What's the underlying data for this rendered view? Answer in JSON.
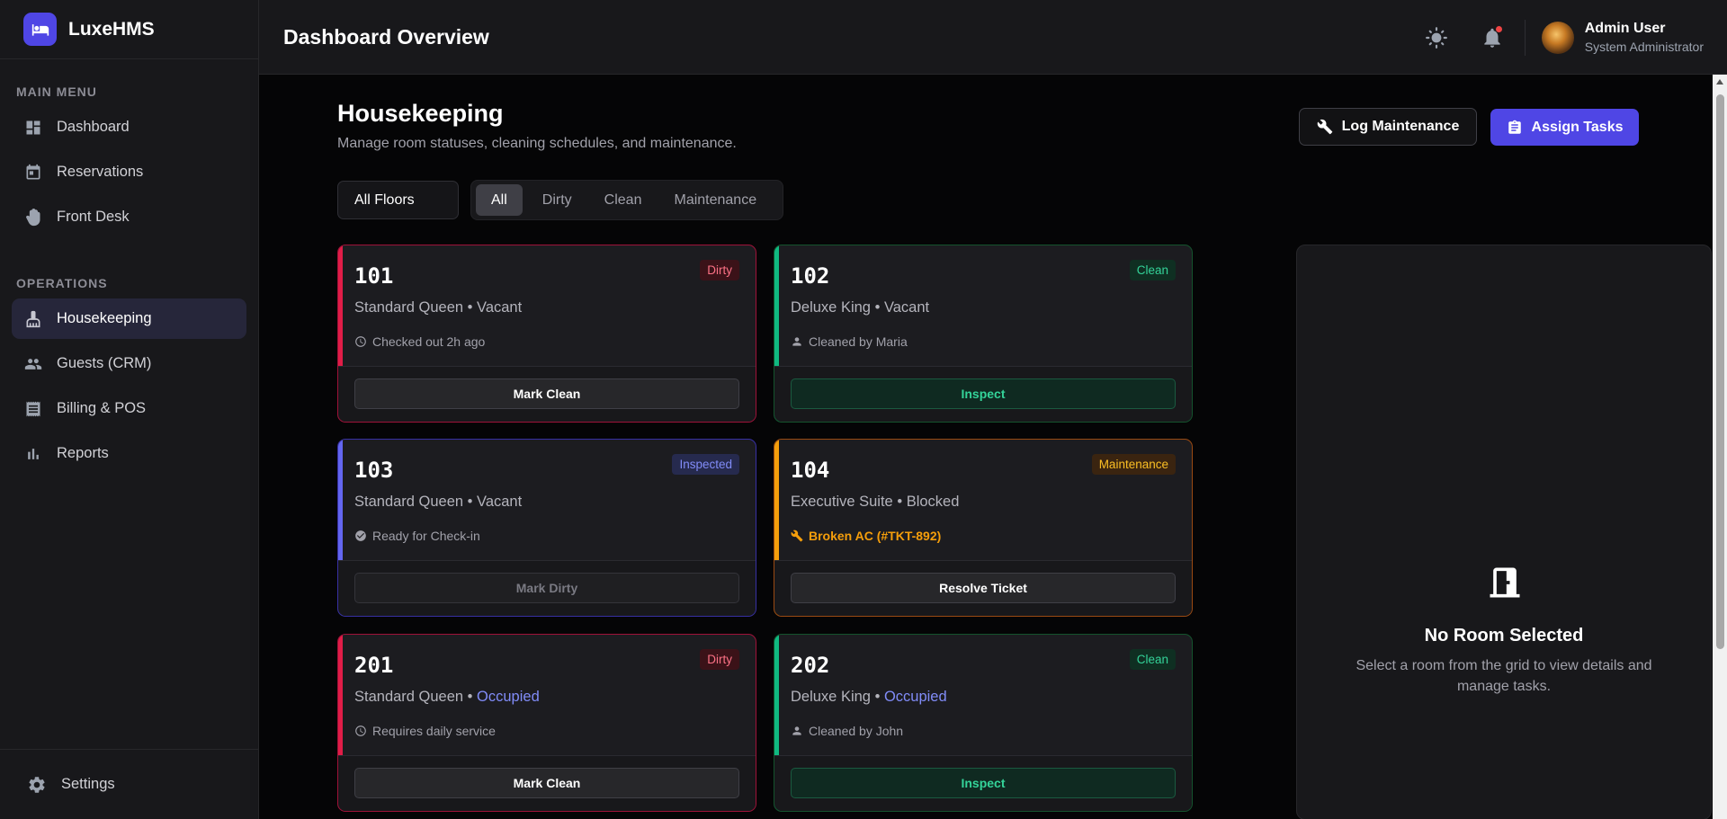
{
  "app": {
    "name": "LuxeHMS"
  },
  "sidebar": {
    "main_menu_label": "MAIN MENU",
    "main_items": [
      {
        "label": "Dashboard",
        "icon": "dashboard-icon"
      },
      {
        "label": "Reservations",
        "icon": "calendar-icon"
      },
      {
        "label": "Front Desk",
        "icon": "hand-icon"
      }
    ],
    "operations_label": "OPERATIONS",
    "ops_items": [
      {
        "label": "Housekeeping",
        "icon": "broom-icon",
        "active": true
      },
      {
        "label": "Guests (CRM)",
        "icon": "users-icon"
      },
      {
        "label": "Billing & POS",
        "icon": "receipt-icon"
      },
      {
        "label": "Reports",
        "icon": "bar-chart-icon"
      }
    ],
    "settings_label": "Settings"
  },
  "header": {
    "title": "Dashboard Overview",
    "user_name": "Admin User",
    "user_role": "System Administrator"
  },
  "page": {
    "title": "Housekeeping",
    "subtitle": "Manage room statuses, cleaning schedules, and maintenance.",
    "log_button": "Log Maintenance",
    "assign_button": "Assign Tasks",
    "floor_filter": "All Floors",
    "status_tabs": [
      "All",
      "Dirty",
      "Clean",
      "Maintenance"
    ],
    "active_tab": "All"
  },
  "rooms": [
    {
      "number": "101",
      "status": "Dirty",
      "type": "Standard Queen",
      "occupancy": "Vacant",
      "note": "Checked out 2h ago",
      "action": "Mark Clean"
    },
    {
      "number": "102",
      "status": "Clean",
      "type": "Deluxe King",
      "occupancy": "Vacant",
      "note": "Cleaned by Maria",
      "action": "Inspect"
    },
    {
      "number": "103",
      "status": "Inspected",
      "type": "Standard Queen",
      "occupancy": "Vacant",
      "note": "Ready for Check-in",
      "action": "Mark Dirty"
    },
    {
      "number": "104",
      "status": "Maintenance",
      "type": "Executive Suite",
      "occupancy": "Blocked",
      "note": "Broken AC (#TKT-892)",
      "action": "Resolve Ticket"
    },
    {
      "number": "201",
      "status": "Dirty",
      "type": "Standard Queen",
      "occupancy": "Occupied",
      "note": "Requires daily service",
      "action": "Mark Clean"
    },
    {
      "number": "202",
      "status": "Clean",
      "type": "Deluxe King",
      "occupancy": "Occupied",
      "note": "Cleaned by John",
      "action": "Inspect"
    }
  ],
  "detail": {
    "title": "No Room Selected",
    "text": "Select a room from the grid to view details and manage tasks."
  },
  "colors": {
    "accent": "#4f46e5",
    "dirty": "#e11d48",
    "clean": "#10b981",
    "inspected": "#6366f1",
    "maintenance": "#f59e0b"
  }
}
